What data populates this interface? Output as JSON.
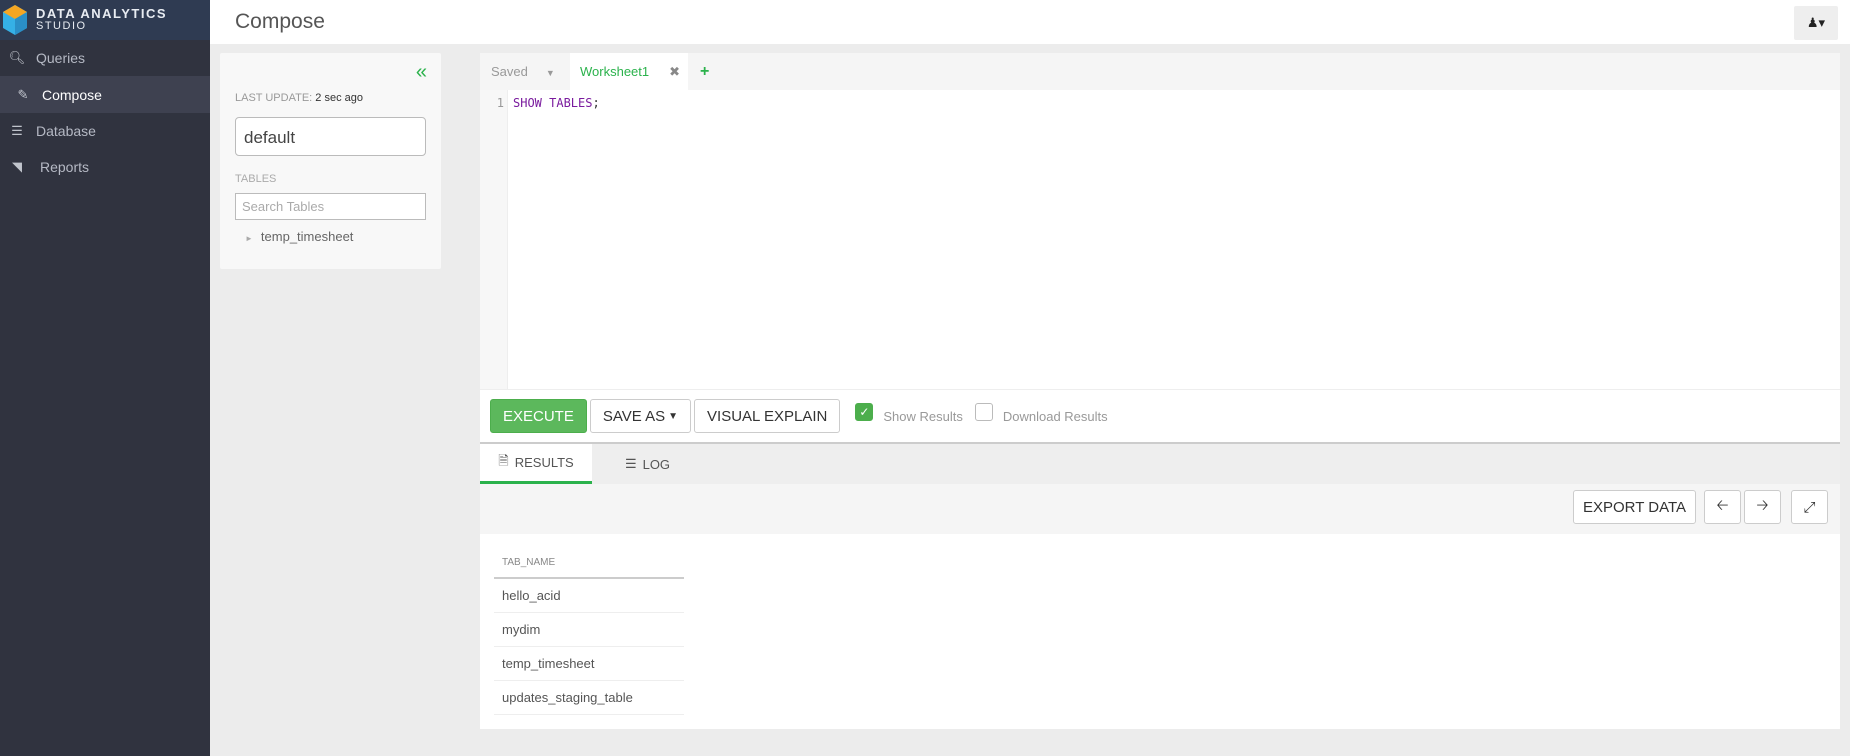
{
  "app": {
    "title_line1": "DATA ANALYTICS",
    "title_line2": "STUDIO"
  },
  "nav": [
    {
      "label": "Queries",
      "icon": "search-icon"
    },
    {
      "label": "Compose",
      "icon": "edit-icon"
    },
    {
      "label": "Database",
      "icon": "database-icon"
    },
    {
      "label": "Reports",
      "icon": "area-chart-icon"
    }
  ],
  "header": {
    "title": "Compose"
  },
  "left": {
    "last_update_label": "LAST UPDATE:",
    "last_update_value": "2 sec ago",
    "database": "default",
    "tables_label": "TABLES",
    "search_placeholder": "Search Tables",
    "tables": [
      "temp_timesheet"
    ]
  },
  "editor": {
    "saved_tab": "Saved",
    "worksheet_tab": "Worksheet1",
    "line": "1",
    "keyword": "SHOW TABLES",
    "punct": ";"
  },
  "toolbar": {
    "execute": "EXECUTE",
    "save_as": "SAVE AS",
    "visual_explain": "VISUAL EXPLAIN",
    "show_results": "Show Results",
    "show_results_checked": true,
    "download_results": "Download Results",
    "download_results_checked": false
  },
  "results": {
    "tabs": [
      "RESULTS",
      "LOG"
    ],
    "export": "EXPORT DATA",
    "column": "TAB_NAME",
    "rows": [
      "hello_acid",
      "mydim",
      "temp_timesheet",
      "updates_staging_table"
    ]
  }
}
